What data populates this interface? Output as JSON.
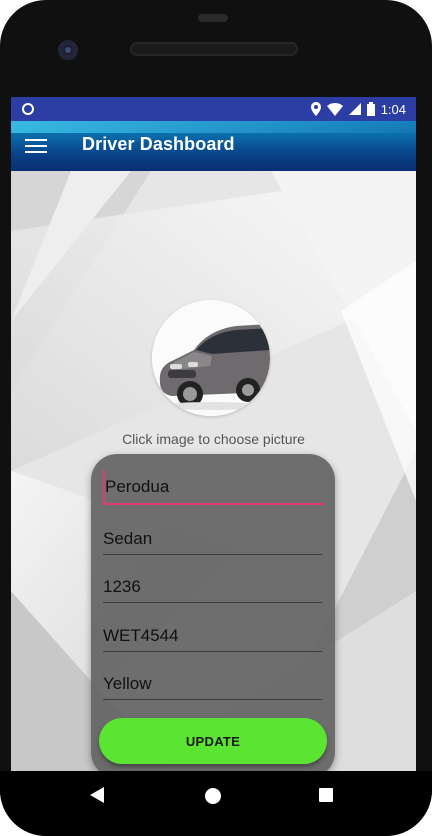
{
  "status_bar": {
    "time": "1:04",
    "icons": [
      "notification-dot-icon",
      "location-icon",
      "wifi-icon",
      "signal-icon",
      "battery-icon"
    ]
  },
  "toolbar": {
    "title": "Driver Dashboard",
    "menu_icon": "hamburger-menu-icon",
    "colors": {
      "start": "#0c8bbf",
      "end": "#0a2f72"
    }
  },
  "profile": {
    "image": "car-photo",
    "hint": "Click image to choose picture"
  },
  "form": {
    "fields": [
      {
        "name": "brand",
        "value": "Perodua"
      },
      {
        "name": "type",
        "value": "Sedan"
      },
      {
        "name": "number",
        "value": "1236"
      },
      {
        "name": "plate",
        "value": "WET4544"
      },
      {
        "name": "color",
        "value": "Yellow"
      }
    ],
    "update_label": "UPDATE",
    "colors": {
      "button": "#5ce432",
      "focus_line": "#e23a74"
    }
  },
  "nav_bar": {
    "icons": [
      "back-icon",
      "home-icon",
      "recent-apps-icon"
    ]
  }
}
